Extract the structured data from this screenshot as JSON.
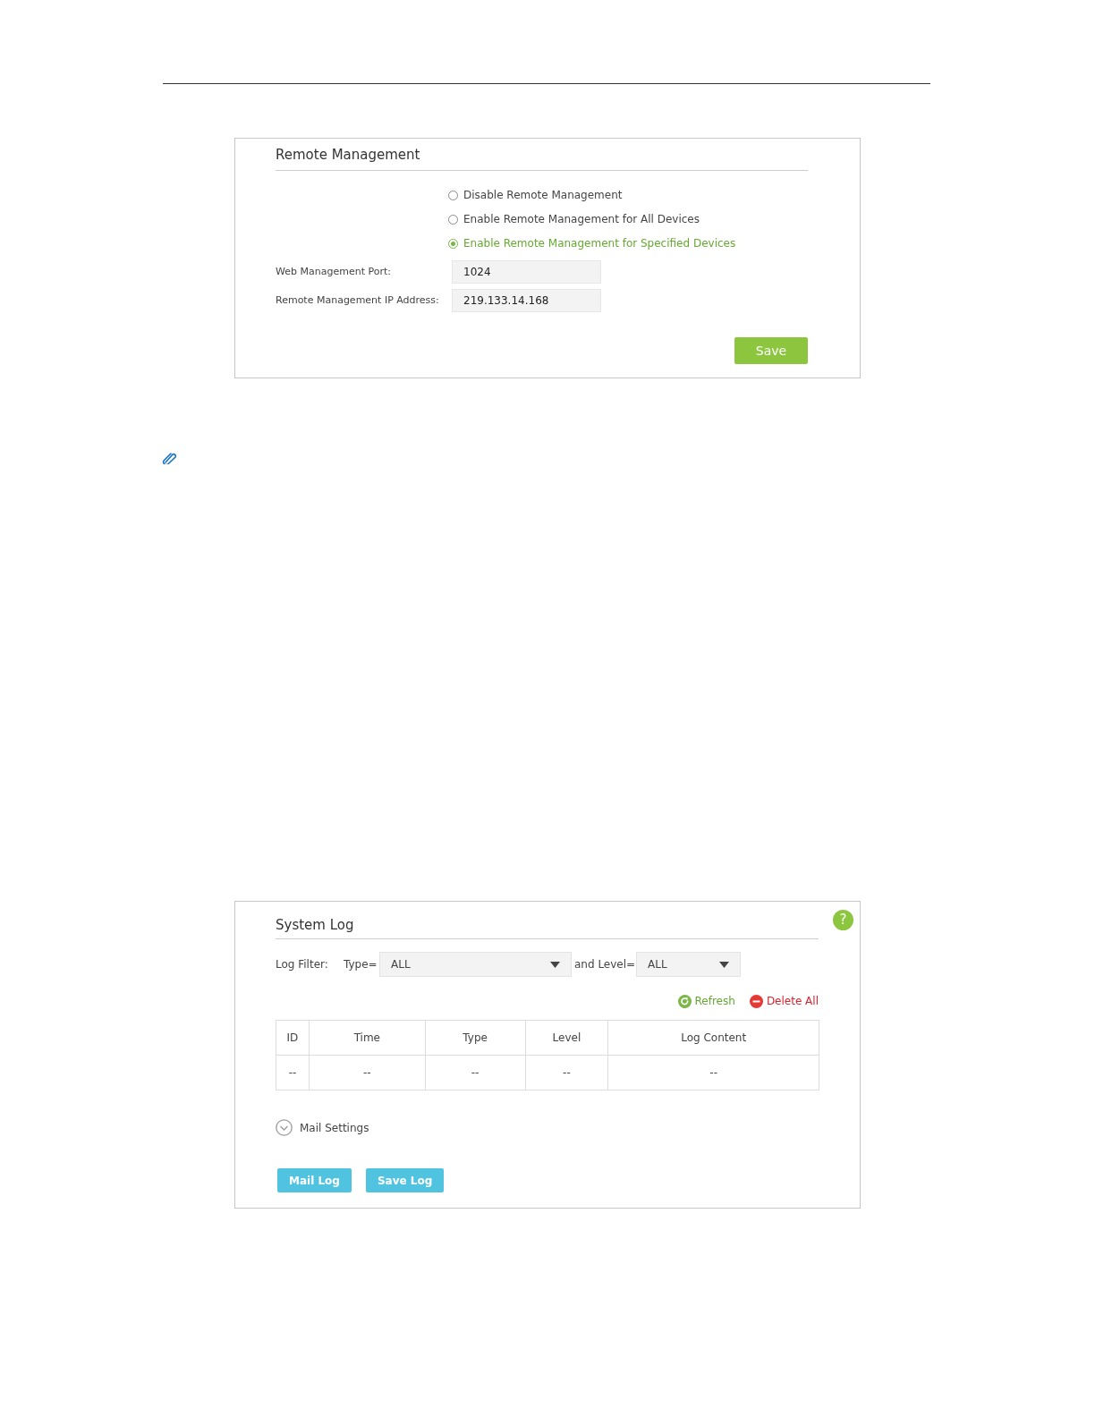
{
  "remote_management": {
    "title": "Remote Management",
    "options": [
      {
        "label": "Disable Remote Management",
        "selected": false
      },
      {
        "label": "Enable Remote Management for All Devices",
        "selected": false
      },
      {
        "label": "Enable Remote Management for Specified Devices",
        "selected": true
      }
    ],
    "fields": [
      {
        "label": "Web Management Port:",
        "value": "1024"
      },
      {
        "label": "Remote Management IP Address:",
        "value": "219.133.14.168"
      }
    ],
    "save_button": "Save"
  },
  "system_log": {
    "title": "System Log",
    "help_icon": "?",
    "filter": {
      "label": "Log Filter:",
      "type_label": "Type=",
      "type_value": "ALL",
      "level_label": "and Level=",
      "level_value": "ALL"
    },
    "actions": [
      "Refresh",
      "Delete All"
    ],
    "table": {
      "columns": [
        "ID",
        "Time",
        "Type",
        "Level",
        "Log Content"
      ],
      "rows": [
        [
          "--",
          "--",
          "--",
          "--",
          "--"
        ]
      ]
    },
    "mail_settings": {
      "label": "Mail Settings",
      "expanded": false
    },
    "buttons": [
      "Mail Log",
      "Save Log"
    ]
  }
}
